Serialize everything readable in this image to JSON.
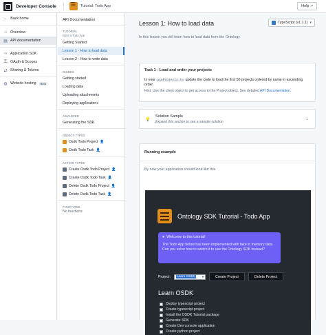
{
  "topbar": {
    "app_title": "Developer Console",
    "tab_label": "Tutorial: Todo App",
    "help_label": "Help"
  },
  "leftnav": {
    "back_label": "Back home",
    "items": [
      {
        "label": "Overview",
        "icon": "home-icon"
      },
      {
        "label": "API documentation",
        "icon": "document-icon",
        "active": true
      },
      {
        "label": "Application SDK",
        "icon": "code-icon"
      },
      {
        "label": "OAuth & Scopes",
        "icon": "key-icon"
      },
      {
        "label": "Sharing & Tokens",
        "icon": "share-icon"
      },
      {
        "label": "Website hosting",
        "icon": "globe-icon",
        "badge": "Beta"
      }
    ]
  },
  "docnav": {
    "header": "API Documentation",
    "tutorial_label": "TUTORIAL",
    "tutorial_sub": "Build a Todo App",
    "tutorial_items": [
      "Getting Started",
      "Lesson 1 - How to load data",
      "Lesson 2 - How to write data"
    ],
    "guides_label": "GUIDES",
    "guides_items": [
      "Getting started",
      "Loading data",
      "Uploading attachments",
      "Deploying applications"
    ],
    "advanced_label": "ADVANCED",
    "advanced_items": [
      "Generating the SDK"
    ],
    "object_types_label": "OBJECT TYPES",
    "object_types": [
      "Osdk Todo Project",
      "Osdk Todo Task"
    ],
    "action_types_label": "ACTION TYPES",
    "action_types": [
      "Create Osdk Todo Project",
      "Create Osdk Todo Task",
      "Delete Osdk Todo Project",
      "Delete Osdk Todo Task"
    ],
    "functions_label": "FUNCTIONS",
    "functions_empty": "No functions"
  },
  "main": {
    "title": "Lesson 1: How to load data",
    "language_select": "TypeScript (v1.1.1)",
    "intro": "In this lesson you will learn how to load data from the Ontology",
    "task_title": "Task 1 - Load and order your projects",
    "task_pre": "In your",
    "task_code": "useProjects.ts",
    "task_post": "update the code to load the first 50 projects ordered by name in ascending order.",
    "hint_pre": "Hint: Use the client object to get access to the Project object. See detailed",
    "hint_link": "API Documentation",
    "hint_post": ".",
    "solution_title": "Solution Sample",
    "solution_sub": "Expand this section to see a sample solution",
    "running_title": "Running example",
    "running_sub": "By now your application should look like this"
  },
  "app": {
    "title": "Ontology SDK Tutorial - Todo App",
    "callout_title": "Welcome to this tutorial!",
    "callout_body": "The Todo App below has been implemented with fake in memory data. Can you solve how to switch it to use the Ontology SDK instead?",
    "project_label": "Project:",
    "project_value": "Learn OSDK",
    "create_button": "Create Project",
    "delete_button": "Delete Project",
    "section_title": "Learn OSDK",
    "todos": [
      "Deploy typescript project",
      "Create typescript project",
      "Install the OSDK Tutorial package",
      "Generate SDK",
      "Create Dev console application",
      "Create python project"
    ]
  }
}
